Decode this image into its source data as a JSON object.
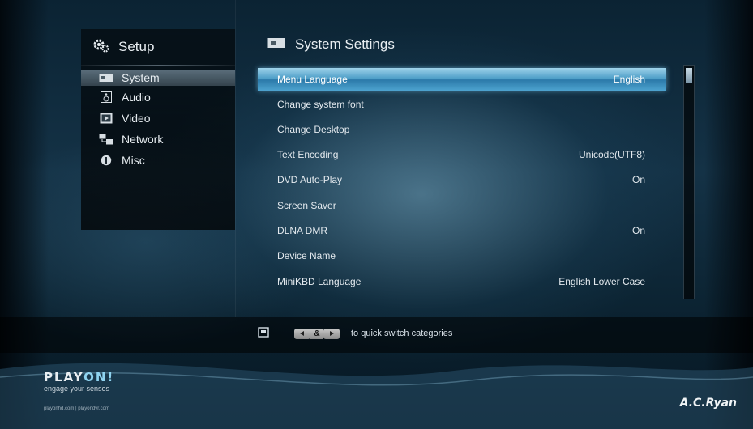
{
  "sidebar": {
    "title": "Setup",
    "items": [
      {
        "label": "System",
        "icon": "system-icon"
      },
      {
        "label": "Audio",
        "icon": "audio-icon"
      },
      {
        "label": "Video",
        "icon": "video-icon"
      },
      {
        "label": "Network",
        "icon": "network-icon"
      },
      {
        "label": "Misc",
        "icon": "info-icon"
      }
    ],
    "selected_index": 0
  },
  "main": {
    "title": "System Settings",
    "settings": [
      {
        "label": "Menu Language",
        "value": "English"
      },
      {
        "label": "Change system font",
        "value": ""
      },
      {
        "label": "Change Desktop",
        "value": ""
      },
      {
        "label": "Text Encoding",
        "value": "Unicode(UTF8)"
      },
      {
        "label": "DVD Auto-Play",
        "value": "On"
      },
      {
        "label": "Screen Saver",
        "value": ""
      },
      {
        "label": "DLNA DMR",
        "value": "On"
      },
      {
        "label": "Device Name",
        "value": ""
      },
      {
        "label": "MiniKBD Language",
        "value": "English Lower Case"
      }
    ],
    "selected_index": 0
  },
  "hint": {
    "amp": "&",
    "text": "to quick switch categories"
  },
  "footer": {
    "brand_part1": "PLAY",
    "brand_part2": "ON!",
    "tagline": "engage your senses",
    "sites": "playonhd.com | playondvr.com",
    "maker": "A.C.Ryan"
  },
  "colors": {
    "highlight": "#4a9cc6",
    "text": "#e3e9ee",
    "background": "#143246"
  }
}
